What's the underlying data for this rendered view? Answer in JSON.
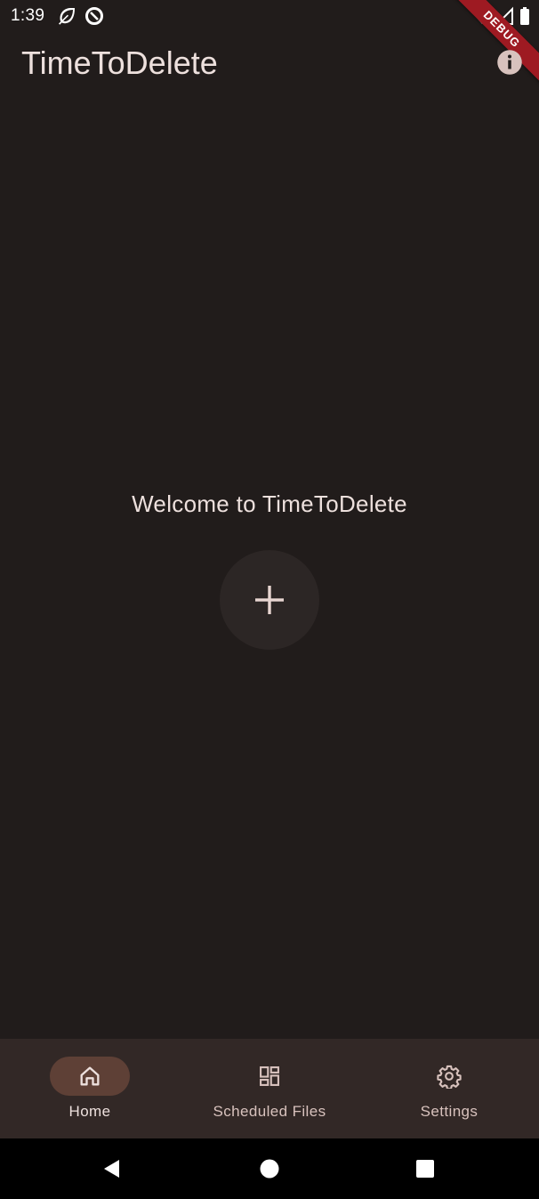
{
  "status_bar": {
    "time": "1:39",
    "icons": [
      "leaf-icon",
      "data-saver-icon",
      "wifi-icon",
      "signal-icon",
      "battery-icon"
    ]
  },
  "debug_banner": {
    "label": "DEBUG",
    "color": "#9e1a22"
  },
  "app_bar": {
    "title": "TimeToDelete",
    "action_icon": "info-icon"
  },
  "main": {
    "welcome_text": "Welcome to TimeToDelete",
    "add_button_icon": "plus-icon"
  },
  "bottom_nav": {
    "items": [
      {
        "label": "Home",
        "icon": "home-icon",
        "active": true
      },
      {
        "label": "Scheduled Files",
        "icon": "dashboard-icon",
        "active": false
      },
      {
        "label": "Settings",
        "icon": "gear-icon",
        "active": false
      }
    ]
  },
  "system_nav": {
    "buttons": [
      "back-icon",
      "home-circle-icon",
      "recents-icon"
    ]
  },
  "colors": {
    "background": "#211c1b",
    "nav_background": "#322826",
    "active_indicator": "#5e4036",
    "text": "#ede0dd",
    "icon_muted": "#d8c2bd"
  }
}
